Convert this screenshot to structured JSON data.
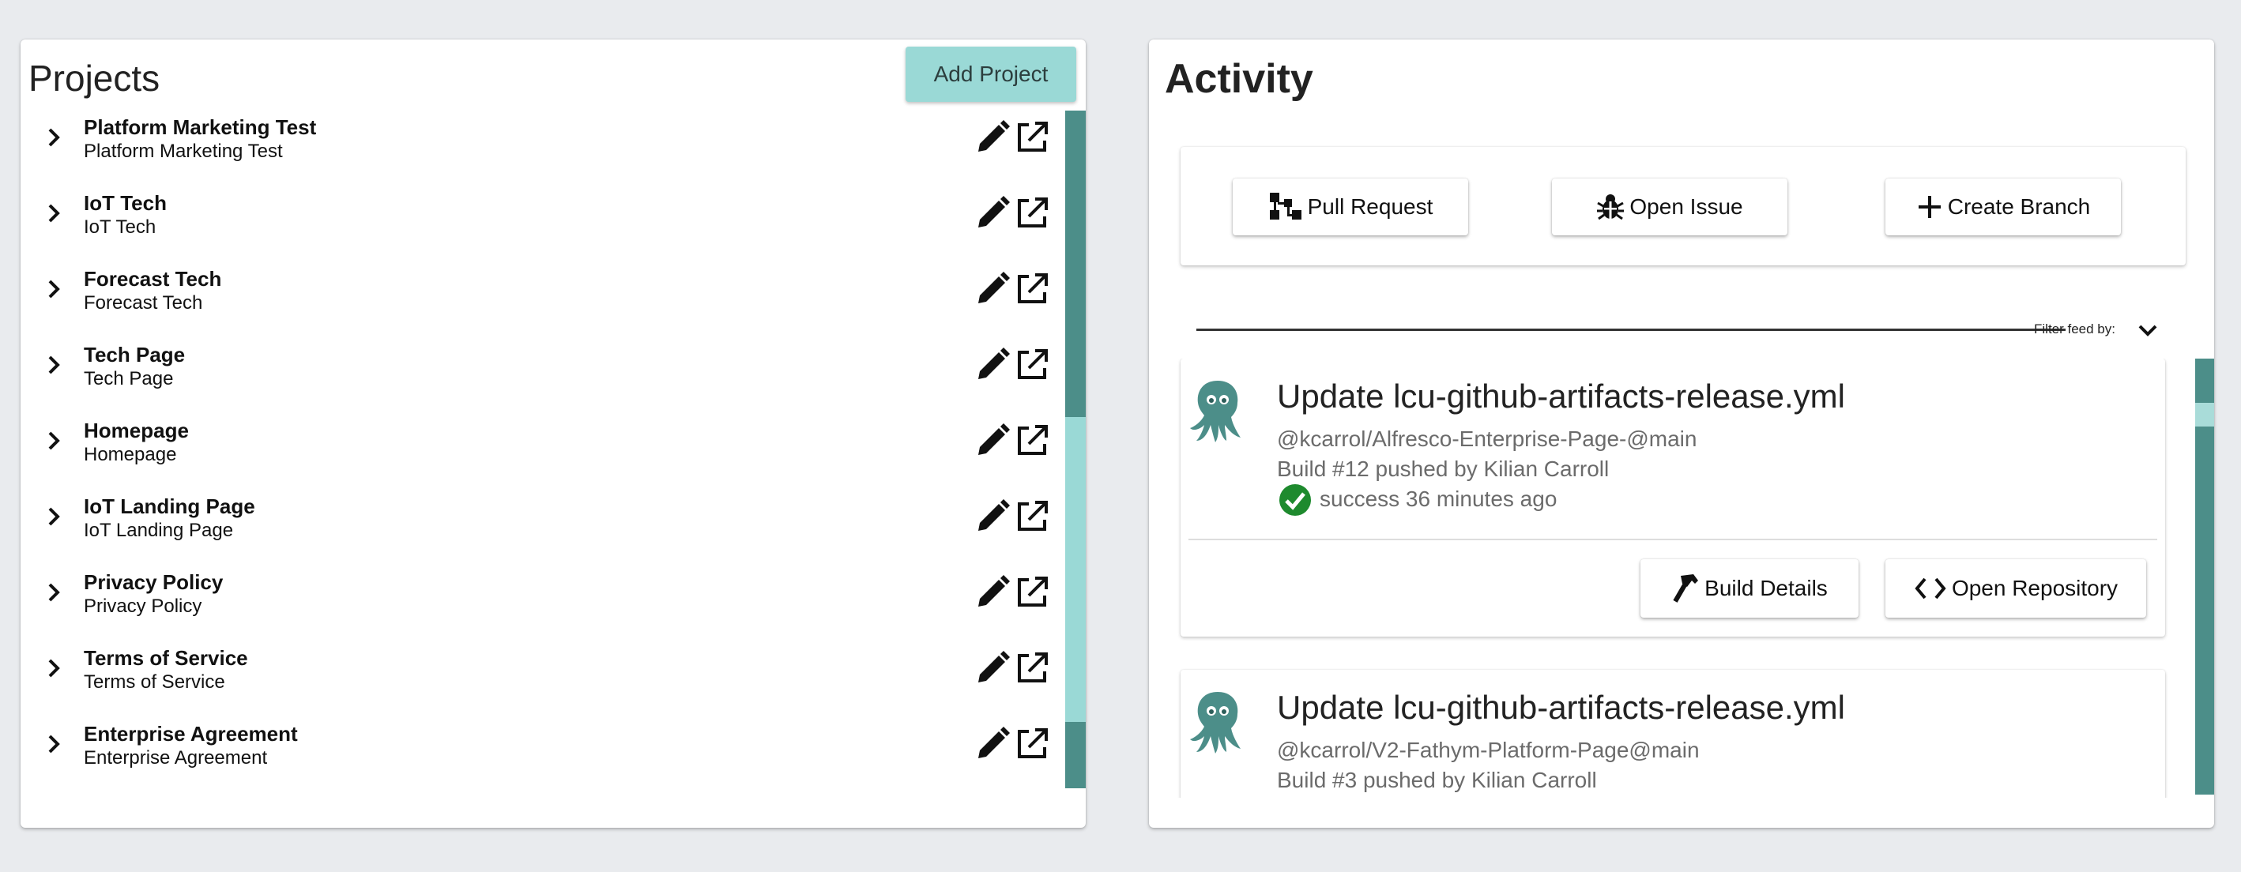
{
  "projects": {
    "title": "Projects",
    "add_button": "Add Project",
    "items": [
      {
        "name": "Platform Marketing Test",
        "subtitle": "Platform Marketing Test"
      },
      {
        "name": "IoT Tech",
        "subtitle": "IoT Tech"
      },
      {
        "name": "Forecast Tech",
        "subtitle": "Forecast Tech"
      },
      {
        "name": "Tech Page",
        "subtitle": "Tech Page"
      },
      {
        "name": "Homepage",
        "subtitle": "Homepage"
      },
      {
        "name": "IoT Landing Page",
        "subtitle": "IoT Landing Page"
      },
      {
        "name": "Privacy Policy",
        "subtitle": "Privacy Policy"
      },
      {
        "name": "Terms of Service",
        "subtitle": "Terms of Service"
      },
      {
        "name": "Enterprise Agreement",
        "subtitle": "Enterprise Agreement"
      }
    ],
    "row_icons": [
      "chevron-right-icon",
      "pencil-icon",
      "open-external-icon"
    ]
  },
  "activity": {
    "title": "Activity",
    "actions": {
      "pull_request": "Pull Request",
      "open_issue": "Open Issue",
      "create_branch": "Create Branch"
    },
    "filter_label": "Filter feed by:",
    "feed": [
      {
        "title": "Update lcu-github-artifacts-release.yml",
        "repo": "@kcarrol/Alfresco-Enterprise-Page-@main",
        "build": "Build #12 pushed by Kilian Carroll",
        "status": "success 36 minutes ago",
        "build_details": "Build Details",
        "open_repository": "Open Repository"
      },
      {
        "title": "Update lcu-github-artifacts-release.yml",
        "repo": "@kcarrol/V2-Fathym-Platform-Page@main",
        "build": "Build #3 pushed by Kilian Carroll"
      }
    ]
  },
  "colors": {
    "background": "#e9ebee",
    "accent_light": "#9ad9d6",
    "accent_dark": "#4c8e89",
    "success": "#1e8a2e"
  }
}
